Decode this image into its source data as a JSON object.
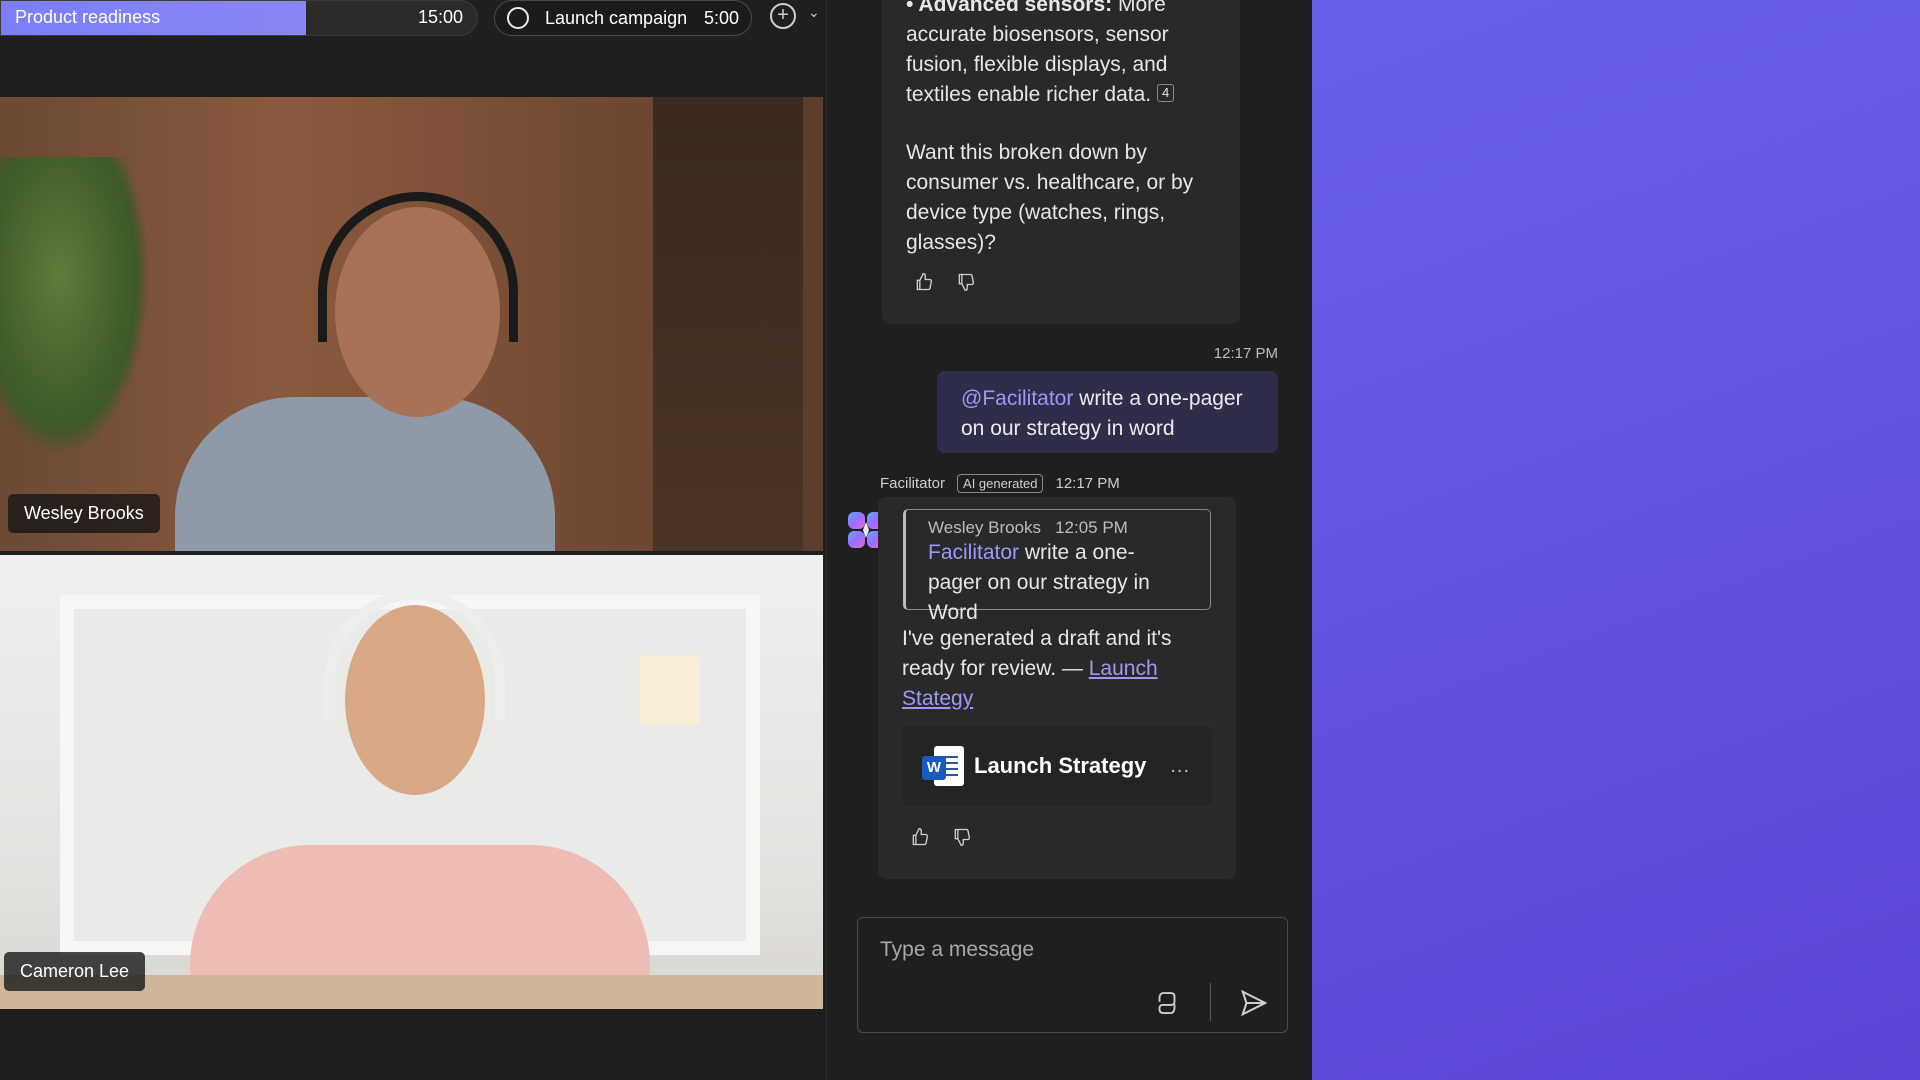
{
  "agenda": {
    "current": {
      "label": "Product readiness",
      "time": "15:00",
      "progress": 0.64
    },
    "next": {
      "label": "Launch campaign",
      "time": "5:00"
    }
  },
  "participants": [
    {
      "name": "Wesley Brooks"
    },
    {
      "name": "Cameron Lee"
    }
  ],
  "chat": {
    "prev_bot_message": {
      "bullet_lead": "• Advanced sensors:",
      "bullet_rest": " More accurate biosensors, sensor fusion, flexible displays, and textiles enable richer data.",
      "citation": "4",
      "question": "Want this broken down by consumer vs. healthcare, or by device type (watches, rings, glasses)?"
    },
    "user_message": {
      "time": "12:17 PM",
      "mention": "@Facilitator",
      "text": " write a one-pager on our strategy in word"
    },
    "bot_message": {
      "sender": "Facilitator",
      "ai_tag": "AI generated",
      "time": "12:17 PM",
      "quote": {
        "author": "Wesley Brooks",
        "time": "12:05 PM",
        "mention": "Facilitator",
        "text": " write a one-pager on our strategy in Word"
      },
      "reply": "I've generated a draft and it's ready for review. — ",
      "link": "Launch Stategy",
      "doc_card": {
        "title": "Launch Strategy",
        "more": "..."
      }
    },
    "composer": {
      "placeholder": "Type a message"
    }
  }
}
